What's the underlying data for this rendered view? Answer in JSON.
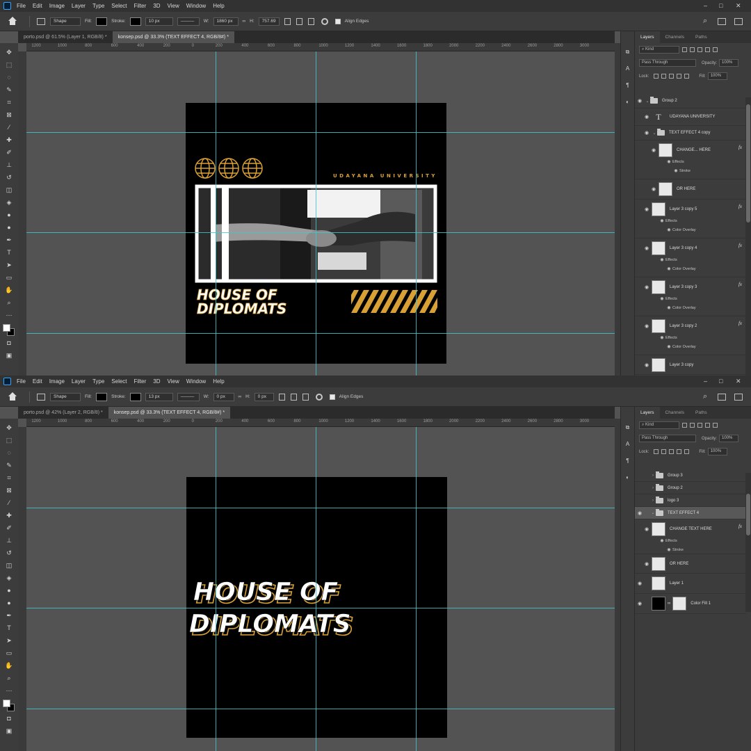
{
  "menu": [
    "File",
    "Edit",
    "Image",
    "Layer",
    "Type",
    "Select",
    "Filter",
    "3D",
    "View",
    "Window",
    "Help"
  ],
  "window_controls": [
    "–",
    "□",
    "✕"
  ],
  "top": {
    "options": {
      "shape_mode": "Shape",
      "fill_label": "Fill:",
      "stroke_label": "Stroke:",
      "stroke_width": "10 px",
      "w_label": "W:",
      "w_value": "1860 px",
      "h_label": "H:",
      "h_value": "757.69",
      "align_edges": "Align Edges"
    },
    "tabs": [
      "porto.psd @ 61.5% (Layer 1, RGB/8) *",
      "konsep.psd @ 33.3% (TEXT EFFECT 4, RGB/8#) *"
    ],
    "ruler": [
      "1200",
      "1000",
      "800",
      "600",
      "400",
      "200",
      "0",
      "200",
      "400",
      "600",
      "800",
      "1000",
      "1200",
      "1400",
      "1600",
      "1800",
      "2000",
      "2200",
      "2400",
      "2600",
      "2800",
      "3000"
    ],
    "poster": {
      "university": "UDAYANA UNIVERSITY",
      "title_line1": "HOUSE OF",
      "title_line2": "DIPLOMATS"
    },
    "layers_panel": {
      "tabs": [
        "Layers",
        "Channels",
        "Paths"
      ],
      "kind": "Kind",
      "blend": "Pass Through",
      "opacity_label": "Opacity:",
      "opacity": "100%",
      "lock_label": "Lock:",
      "fill_label": "Fill:",
      "fill": "100%",
      "layers": [
        {
          "name": "Group 2",
          "kind": "group"
        },
        {
          "name": "UDAYANA UNIVERSITY",
          "kind": "text"
        },
        {
          "name": "TEXT EFFECT 4 copy",
          "kind": "group"
        },
        {
          "name": "CHANGE... HERE",
          "kind": "smart",
          "effects": [
            "Effects",
            "Stroke"
          ]
        },
        {
          "name": "OR HERE",
          "kind": "smart"
        },
        {
          "name": "Layer 3 copy 5",
          "kind": "smart",
          "effects": [
            "Effects",
            "Color Overlay"
          ]
        },
        {
          "name": "Layer 3 copy 4",
          "kind": "smart",
          "effects": [
            "Effects",
            "Color Overlay"
          ]
        },
        {
          "name": "Layer 3 copy 3",
          "kind": "smart",
          "effects": [
            "Effects",
            "Color Overlay"
          ]
        },
        {
          "name": "Layer 3 copy 2",
          "kind": "smart",
          "effects": [
            "Effects",
            "Color Overlay"
          ]
        },
        {
          "name": "Layer 3 copy",
          "kind": "smart"
        }
      ]
    }
  },
  "bottom": {
    "options": {
      "shape_mode": "Shape",
      "fill_label": "Fill:",
      "stroke_label": "Stroke:",
      "stroke_width": "13 px",
      "w_label": "W:",
      "w_value": "0 px",
      "h_label": "H:",
      "h_value": "0 px",
      "align_edges": "Align Edges"
    },
    "tabs": [
      "porto.psd @ 42% (Layer 2, RGB/8) *",
      "konsep.psd @ 33.3% (TEXT EFFECT 4, RGB/8#) *"
    ],
    "ruler": [
      "1200",
      "1000",
      "800",
      "600",
      "400",
      "200",
      "0",
      "200",
      "400",
      "600",
      "800",
      "1000",
      "1200",
      "1400",
      "1600",
      "1800",
      "2000",
      "2200",
      "2400",
      "2600",
      "2800",
      "3000"
    ],
    "poster": {
      "title_line1": "HOUSE OF",
      "title_line2": "DIPLOMATS"
    },
    "layers_panel": {
      "tabs": [
        "Layers",
        "Channels",
        "Paths"
      ],
      "kind": "Kind",
      "blend": "Pass Through",
      "opacity_label": "Opacity:",
      "opacity": "100%",
      "lock_label": "Lock:",
      "fill_label": "Fill:",
      "fill": "100%",
      "layers": [
        {
          "name": "Group 3",
          "kind": "group"
        },
        {
          "name": "Group 2",
          "kind": "group"
        },
        {
          "name": "logo 3",
          "kind": "group"
        },
        {
          "name": "TEXT EFFECT 4",
          "kind": "group",
          "selected": true
        },
        {
          "name": "CHANGE TEXT HERE",
          "kind": "smart",
          "effects": [
            "Effects",
            "Stroke"
          ]
        },
        {
          "name": "OR HERE",
          "kind": "smart"
        },
        {
          "name": "Layer 1",
          "kind": "pixel"
        },
        {
          "name": "Color Fill 1",
          "kind": "fill"
        }
      ]
    }
  },
  "colors": {
    "gold": "#d9a036",
    "guide": "#3fc6cd",
    "panel": "#3c3c3c",
    "canvas": "#535353"
  }
}
